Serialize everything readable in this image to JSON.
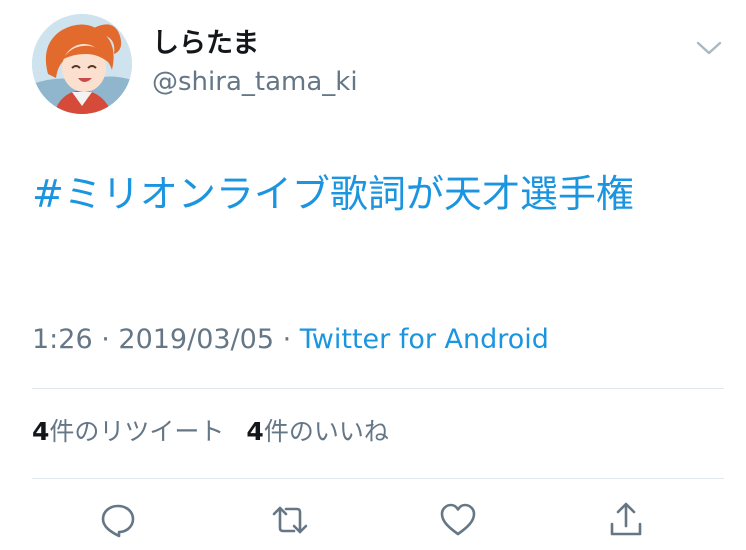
{
  "user": {
    "display_name": "しらたま",
    "handle": "@shira_tama_ki"
  },
  "tweet": {
    "text": "#ミリオンライブ歌詞が天才選手権",
    "time": "1:26",
    "date": "2019/03/05",
    "separator": " · ",
    "source": "Twitter for Android"
  },
  "stats": {
    "retweets_count": "4",
    "retweets_label": "件のリツイート",
    "likes_count": "4",
    "likes_label": "件のいいね"
  },
  "icons": {
    "menu": "chevron-down-icon",
    "reply": "reply-icon",
    "retweet": "retweet-icon",
    "like": "heart-icon",
    "share": "share-icon"
  },
  "colors": {
    "link": "#1b95e0",
    "secondary_text": "#657786",
    "primary_text": "#14171a",
    "divider": "#e1e8ed"
  }
}
